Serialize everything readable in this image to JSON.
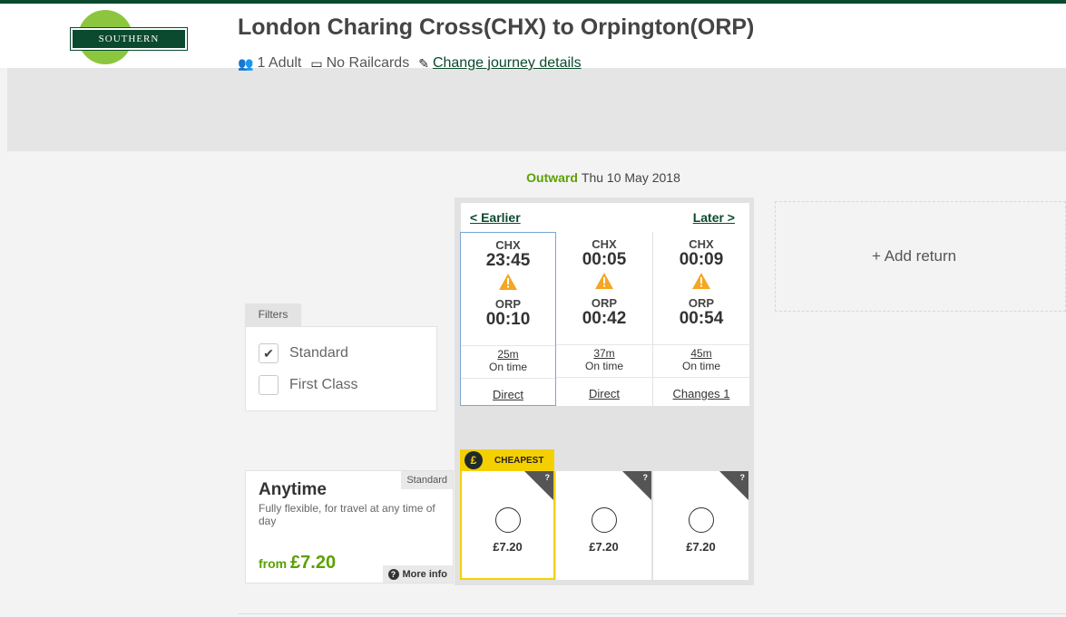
{
  "brand": {
    "logo_text": "SOUTHERN"
  },
  "journey": {
    "title": "London Charing Cross(CHX) to Orpington(ORP)",
    "passengers": "1 Adult",
    "railcards": "No Railcards",
    "change_link": "Change journey details"
  },
  "outward": {
    "label": "Outward",
    "date": "Thu 10 May 2018"
  },
  "nav": {
    "earlier": "< Earlier",
    "later": "Later >"
  },
  "services": [
    {
      "from": "CHX",
      "depart": "23:45",
      "to": "ORP",
      "arrive": "00:10",
      "duration": "25m",
      "status": "On time",
      "changes": "Direct",
      "price": "£7.20"
    },
    {
      "from": "CHX",
      "depart": "00:05",
      "to": "ORP",
      "arrive": "00:42",
      "duration": "37m",
      "status": "On time",
      "changes": "Direct",
      "price": "£7.20"
    },
    {
      "from": "CHX",
      "depart": "00:09",
      "to": "ORP",
      "arrive": "00:54",
      "duration": "45m",
      "status": "On time",
      "changes": "Changes 1",
      "price": "£7.20"
    }
  ],
  "add_return": {
    "label": "+ Add return"
  },
  "filters": {
    "tab_label": "Filters",
    "options": [
      {
        "label": "Standard",
        "checked": true
      },
      {
        "label": "First Class",
        "checked": false
      }
    ]
  },
  "ticket": {
    "class_tag": "Standard",
    "name": "Anytime",
    "description": "Fully flexible, for travel at any time of day",
    "from_label": "from",
    "from_price": "£7.20",
    "more_info": "More info"
  },
  "badge": {
    "icon": "£",
    "label": "CHEAPEST"
  },
  "help_mark": "?",
  "colors": {
    "brand_green": "#0b4a2e",
    "accent_green": "#5aa100",
    "logo_circle": "#8cc63f",
    "cheapest_yellow": "#f5d000",
    "warning": "#f5a623"
  }
}
